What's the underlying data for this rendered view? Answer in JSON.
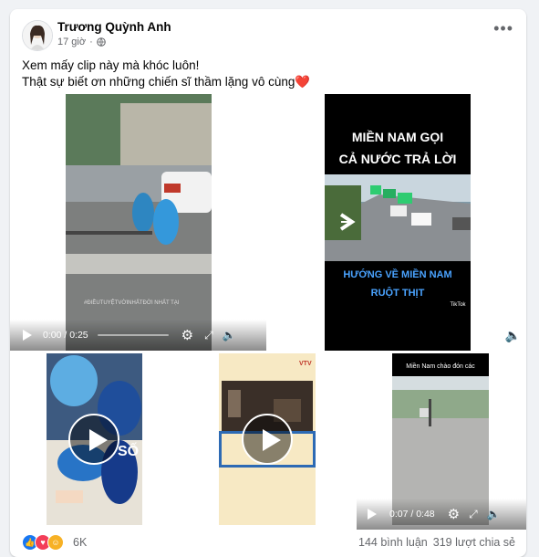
{
  "post": {
    "author": "Trương Quỳnh Anh",
    "time": "17 giờ",
    "privacy_icon": "public-globe-icon",
    "more_icon": "more-options-icon",
    "text_line1": "Xem mấy clip này mà khóc luôn!",
    "text_line2": "Thật sự biết ơn những chiến sĩ thầm lặng vô cùng",
    "heart_emoji": "❤️"
  },
  "videos": {
    "v1": {
      "time": "0:00 / 0:25",
      "overlay": "#ĐIỀUTUYỆTVỜINHẤTĐỜI NHẤT TẠI"
    },
    "v2": {
      "title_line1": "MIỀN NAM GỌI",
      "title_line2": "CẢ NƯỚC TRẢ LỜI",
      "subtitle_line1": "HƯỚNG VỀ MIỀN NAM",
      "subtitle_line2": "RUỘT THỊT",
      "tiktok": "TikTok"
    },
    "v5": {
      "caption": "Miền Nam chào đón các",
      "time": "0:07 / 0:48"
    },
    "v4": {
      "badge": "VTV"
    }
  },
  "stats": {
    "reactions_count": "6K",
    "comments": "144 bình luận",
    "shares": "319 lượt chia sẻ"
  },
  "colors": {
    "like": "#1877f2",
    "love": "#f33e58",
    "care": "#f7b125"
  }
}
